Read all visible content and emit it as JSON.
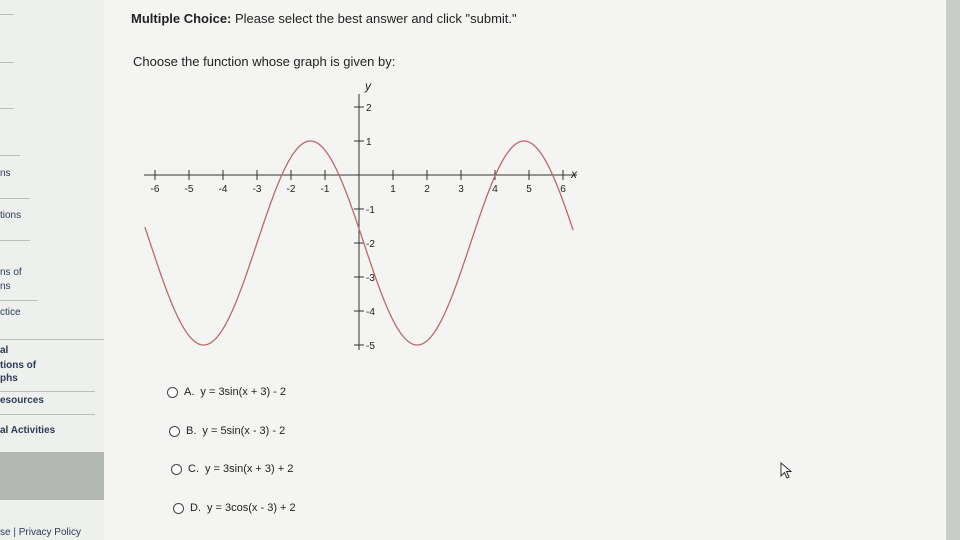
{
  "header": {
    "prefix": "Multiple Choice:",
    "text": " Please select the best answer and click \"submit.\""
  },
  "question": "Choose the function whose graph is given by:",
  "graph": {
    "x_axis_label": "x",
    "y_axis_label": "y",
    "x_ticks": [
      "-6",
      "-5",
      "-4",
      "-3",
      "-2",
      "-1",
      "1",
      "2",
      "3",
      "4",
      "5",
      "6"
    ],
    "y_ticks": [
      "2",
      "1",
      "-1",
      "-2",
      "-3",
      "-4",
      "-5"
    ],
    "curve_color": "#c0666a"
  },
  "choices": [
    {
      "letter": "A.",
      "text": "y = 3sin(x + 3) - 2"
    },
    {
      "letter": "B.",
      "text": "y = 5sin(x - 3) - 2"
    },
    {
      "letter": "C.",
      "text": "y = 3sin(x + 3) + 2"
    },
    {
      "letter": "D.",
      "text": "y = 3cos(x - 3) + 2"
    }
  ],
  "sidebar": {
    "items": [
      "ns",
      "tions",
      "ns of",
      "ns",
      "ctice",
      "al",
      "tions of",
      "phs",
      "esources",
      "al Activities"
    ],
    "footer": "se  |  Privacy Policy"
  }
}
